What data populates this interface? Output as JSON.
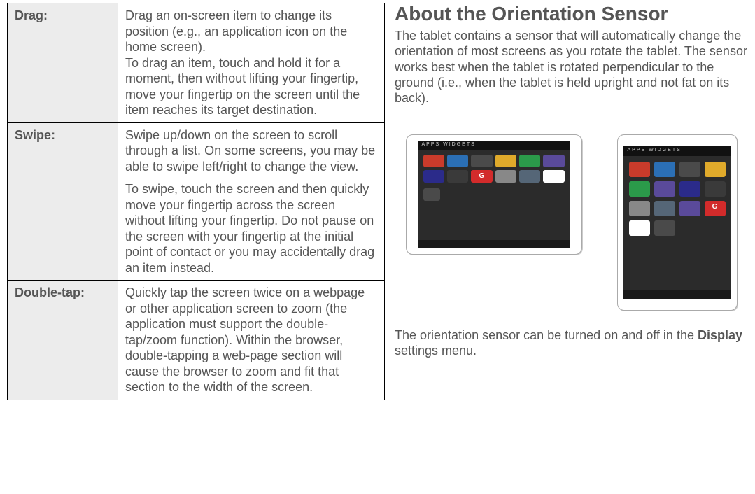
{
  "gestures": {
    "drag": {
      "term": "Drag:",
      "desc1": "Drag an on-screen item to change its position (e.g., an application icon on the home screen).",
      "desc2": "To drag an item, touch and hold it for a moment, then without lifting your fingertip, move your fingertip on the screen until the item reaches its target destination."
    },
    "swipe": {
      "term": "Swipe:",
      "desc1": "Swipe up/down on the screen to scroll through a list. On some screens, you may be able to swipe left/right to change the view.",
      "desc2": "To swipe, touch the screen and then quickly move your fingertip across the screen without lifting your fingertip. Do not pause on the screen with your fingertip at the initial point of contact or you may accidentally drag an item instead."
    },
    "doubletap": {
      "term": "Double-tap:",
      "desc1": "Quickly tap the screen twice on a webpage or other application screen to zoom (the application must support the double-tap/zoom function). Within the browser, double-tapping a web-page section will cause the browser to zoom and fit that section to the width of the screen."
    }
  },
  "orientation": {
    "heading": "About the Orientation Sensor",
    "intro": "The tablet contains a sensor that will automatically change the orientation of most screens as you rotate the tablet. The sensor works best when the tablet is rotated perpendicular to the ground (i.e., when the tablet is held upright and not fat on its back).",
    "footer_pre": "The orientation sensor can be turned on and off in the ",
    "footer_bold": "Display",
    "footer_post": " settings menu.",
    "topbar_text": "APPS   WIDGETS",
    "g_label": "G"
  }
}
